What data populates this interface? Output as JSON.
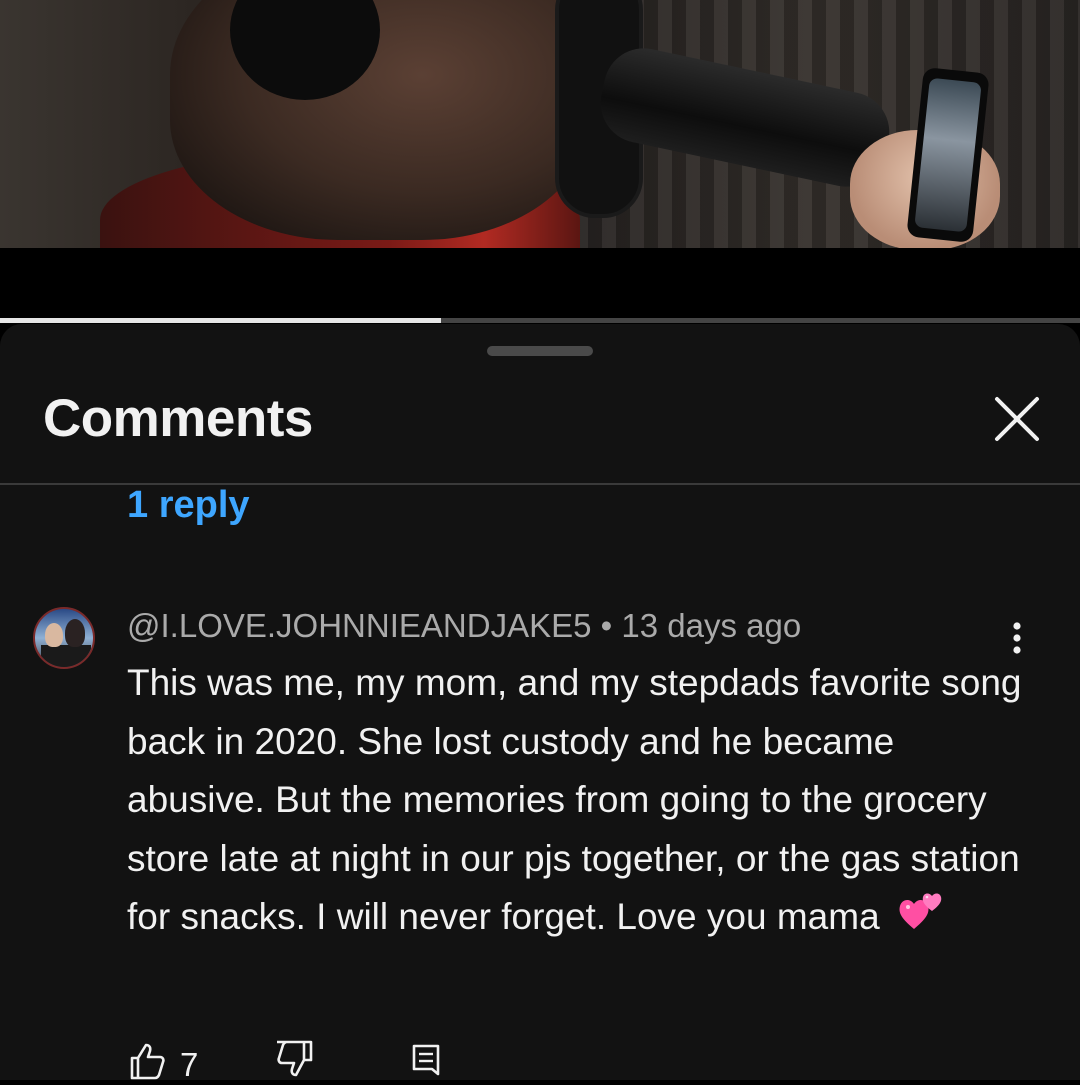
{
  "video": {
    "progress_fraction": 0.408
  },
  "comments_panel": {
    "title": "Comments",
    "close_icon": "close-icon",
    "previous_thread": {
      "replies_link": "1 reply"
    },
    "comment": {
      "author": "@I.LOVE.JOHNNIEANDJAKE5",
      "separator": "•",
      "time": "13 days ago",
      "text": "This was me, my mom, and my stepdads favorite song back in 2020. She lost custody and he became abusive. But the memories from going to the grocery store late at night in our pjs together, or the gas station for snacks. I will never forget. Love you mama",
      "emoji": "two-hearts-emoji",
      "like_count": "7",
      "icons": [
        "like-icon",
        "dislike-icon",
        "reply-icon",
        "more-vert-icon"
      ]
    }
  },
  "colors": {
    "sheet_bg": "#121212",
    "accent_link": "#3ea6ff",
    "text_primary": "#f1f1f1",
    "text_secondary": "#aaaaaa",
    "emoji_pink": "#ff4fa3"
  }
}
